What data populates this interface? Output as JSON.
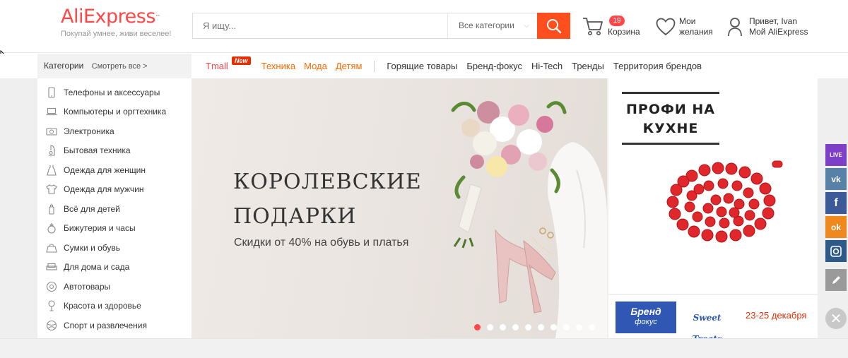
{
  "header": {
    "logo_text": "AliExpress",
    "logo_tm": "™",
    "tagline": "Покупай умнее, живи веселее!",
    "search_placeholder": "Я ищу...",
    "search_category": "Все категории",
    "cart_count": "19",
    "cart_label": "Корзина",
    "wishlist_line1": "Мои",
    "wishlist_line2": "желания",
    "account_line1": "Привет, Ivan",
    "account_line2": "Мой AliExpress"
  },
  "nav": {
    "categories_label": "Категории",
    "see_all": "Смотреть все >",
    "tmall": "Tmall",
    "tmall_badge": "New",
    "hot_links": [
      "Техника",
      "Мода",
      "Детям"
    ],
    "links": [
      "Горящие товары",
      "Бренд-фокус",
      "Hi-Tech",
      "Тренды",
      "Территория брендов"
    ]
  },
  "sidebar": {
    "items": [
      {
        "label": "Телефоны и аксессуары",
        "icon": "phone-icon"
      },
      {
        "label": "Компьютеры и оргтехника",
        "icon": "laptop-icon"
      },
      {
        "label": "Электроника",
        "icon": "camera-icon"
      },
      {
        "label": "Бытовая техника",
        "icon": "appliance-icon"
      },
      {
        "label": "Одежда для женщин",
        "icon": "dress-icon"
      },
      {
        "label": "Одежда для мужчин",
        "icon": "shirt-icon"
      },
      {
        "label": "Всё для детей",
        "icon": "bottle-icon"
      },
      {
        "label": "Бижутерия и часы",
        "icon": "ring-icon"
      },
      {
        "label": "Сумки и обувь",
        "icon": "bag-icon"
      },
      {
        "label": "Для дома и сада",
        "icon": "sofa-icon"
      },
      {
        "label": "Автотовары",
        "icon": "wheel-icon"
      },
      {
        "label": "Красота и здоровье",
        "icon": "lipstick-icon"
      },
      {
        "label": "Спорт и развлечения",
        "icon": "ball-icon"
      }
    ]
  },
  "banner": {
    "title": "КОРОЛЕВСКИЕ ПОДАРКИ",
    "subtitle": "Скидки от 40% на обувь и платья",
    "slide_count": 10,
    "active_slide": 1
  },
  "promo": {
    "title_line1": "ПРОФИ НА",
    "title_line2": "КУХНЕ"
  },
  "brand_promo": {
    "logo_line1": "Бренд",
    "logo_line2": "фокус",
    "partner": "Sweet Treats",
    "dates": "23-25 декабря"
  },
  "social": {
    "live_label": "LIVE",
    "vk_label": "vk",
    "fb_label": "f",
    "ok_label": "ok"
  },
  "colors": {
    "brand_red": "#ff4747",
    "search_orange": "#ff4f1f",
    "hot_orange": "#ff6a00"
  }
}
